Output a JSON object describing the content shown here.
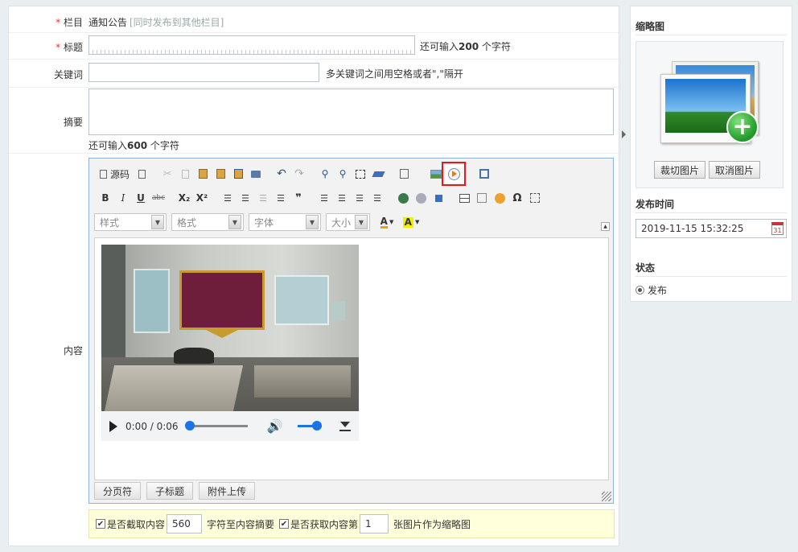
{
  "form": {
    "column": {
      "label": "栏目",
      "value": "通知公告",
      "hint": "[同时发布到其他栏目]"
    },
    "title": {
      "label": "标题",
      "hint_prefix": "还可输入",
      "hint_count": "200",
      "hint_suffix": "个字符",
      "value": ""
    },
    "keywords": {
      "label": "关键词",
      "hint": "多关键词之间用空格或者\",\"隔开",
      "value": ""
    },
    "summary": {
      "label": "摘要",
      "hint_prefix": "还可输入",
      "hint_count": "600",
      "hint_suffix": "个字符"
    },
    "content": {
      "label": "内容"
    },
    "required_mark": "*"
  },
  "editor": {
    "source_label": "源码",
    "combos": {
      "style": "样式",
      "format": "格式",
      "font": "字体",
      "size": "大小"
    },
    "toolbar2_text": {
      "bold": "B",
      "italic": "I",
      "underline": "U",
      "strike": "abc",
      "subscript": "X₂",
      "superscript": "X²",
      "quote": "❞",
      "omega": "Ω"
    },
    "video": {
      "time": "0:00 / 0:06",
      "progress": 0.0,
      "volume": 0.8
    },
    "footer_buttons": [
      "分页符",
      "子标题",
      "附件上传"
    ]
  },
  "bottom": {
    "truncate_label": "是否截取内容",
    "truncate_value": "560",
    "truncate_suffix": "字符至内容摘要",
    "thumb_label": "是否获取内容第",
    "thumb_value": "1",
    "thumb_suffix": "张图片作为缩略图"
  },
  "sidebar": {
    "thumb_title": "缩略图",
    "crop_label": "裁切图片",
    "cancel_label": "取消图片",
    "time_title": "发布时间",
    "time_value": "2019-11-15 15:32:25",
    "status_title": "状态",
    "status_option": "发布"
  },
  "colors": {
    "highlight": "#e0191b",
    "editor_border": "#8fb3d8",
    "required": "#e33333"
  }
}
